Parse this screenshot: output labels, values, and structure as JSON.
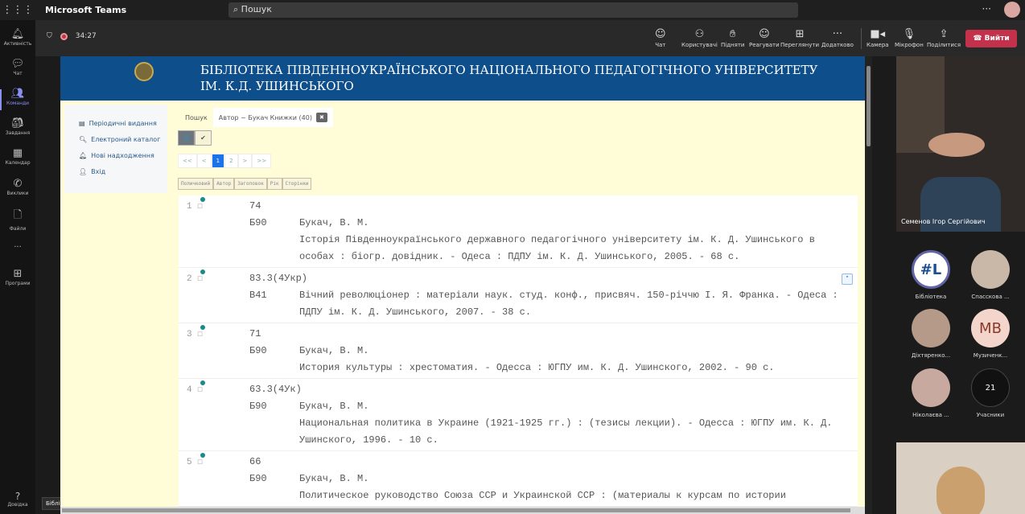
{
  "teams": {
    "app_name": "Microsoft Teams",
    "search_placeholder": "Пошук",
    "more": "···",
    "timer": "34:27",
    "rail": [
      {
        "icon": "bell-icon",
        "label": "Активність"
      },
      {
        "icon": "chat-icon",
        "label": "Чат"
      },
      {
        "icon": "teams-icon",
        "label": "Команди"
      },
      {
        "icon": "assignments-icon",
        "label": "Завдання"
      },
      {
        "icon": "calendar-icon",
        "label": "Календар"
      },
      {
        "icon": "phone-icon",
        "label": "Виклики"
      },
      {
        "icon": "file-icon",
        "label": "Файли"
      },
      {
        "icon": "more-icon",
        "label": "···"
      },
      {
        "icon": "apps-icon",
        "label": "Програми"
      }
    ],
    "help": "Довідка",
    "tooltip": "Бібліотека",
    "controls": [
      {
        "icon": "chat-icon",
        "label": "Чат"
      },
      {
        "icon": "people-icon",
        "label": "Користувачі"
      },
      {
        "icon": "hand-icon",
        "label": "Підняти"
      },
      {
        "icon": "emoji-icon",
        "label": "Реагувати"
      },
      {
        "icon": "grid-icon",
        "label": "Переглянути"
      },
      {
        "icon": "more-icon",
        "label": "Додатково"
      },
      {
        "icon": "camera-icon",
        "label": "Камера"
      },
      {
        "icon": "mic-off-icon",
        "label": "Мікрофон"
      },
      {
        "icon": "share-icon",
        "label": "Поділитися"
      }
    ],
    "leave": "Вийти"
  },
  "site": {
    "title_line1": "БІБЛІОТЕКА ПІВДЕННОУКРАЇНСЬКОГО НАЦІОНАЛЬНОГО ПЕДАГОГІЧНОГО УНІВЕРСИТЕТУ",
    "title_line2": "ІМ. К.Д. УШИНСЬКОГО",
    "menu": [
      "Періодичні видання",
      "Електроний каталог",
      "Нові надходження",
      "Вхід"
    ],
    "tabs": {
      "search": "Пошук",
      "active": "Автор ~ Букач Книжки (40)",
      "close": "✖"
    },
    "pager": [
      "<<",
      "<",
      "1",
      "2",
      ">",
      ">>"
    ],
    "columns": [
      "Поличковий",
      "Автор",
      "Заголовок",
      "Рік",
      "Сторінки"
    ],
    "records": [
      {
        "n": "1",
        "shelf": "74",
        "code": "Б90",
        "author": "Букач, В. М.",
        "desc": "Історія Південноукраїнського державного педагогічного університету ім. К. Д. Ушинського в особах : біогр. довідник. - Одеса : ПДПУ ім. К. Д. Ушинського, 2005. - 68 с."
      },
      {
        "n": "2",
        "shelf": "83.3(4Укр)",
        "code": "В41",
        "author": "",
        "desc": "Вічний революціонер : матеріали наук. студ. конф., присвяч. 150-річчю І. Я. Франка. - Одеса : ПДПУ ім. К. Д. Ушинського, 2007. - 38 с."
      },
      {
        "n": "3",
        "shelf": "71",
        "code": "Б90",
        "author": "Букач, В. М.",
        "desc": "История культуры : хрестоматия. - Одесса : ЮГПУ им. К. Д. Ушинского, 2002. - 90 с."
      },
      {
        "n": "4",
        "shelf": "63.3(4Ук)",
        "code": "Б90",
        "author": "Букач, В. М.",
        "desc": "Национальная политика в Украине (1921-1925 гг.) : (тезисы лекции). - Одесса : ЮГПУ им. К. Д. Ушинского, 1996. - 10 с."
      },
      {
        "n": "5",
        "shelf": "66",
        "code": "Б90",
        "author": "Букач, В. М.",
        "desc": "Политическое руководство Союза ССР и Украинской ССР : (материалы к курсам по истории"
      }
    ]
  },
  "participants": {
    "main_video": "Семенов Ігор Сергійович",
    "tiles": [
      {
        "name": "Бібліотека",
        "initials": "#L"
      },
      {
        "name": "Спасскова ...",
        "initials": ""
      },
      {
        "name": "Діхтяренко...",
        "initials": ""
      },
      {
        "name": "Музиченк...",
        "initials": "MB"
      },
      {
        "name": "Ніколаєва ...",
        "initials": ""
      },
      {
        "name": "Учасники",
        "initials": "21"
      }
    ]
  }
}
